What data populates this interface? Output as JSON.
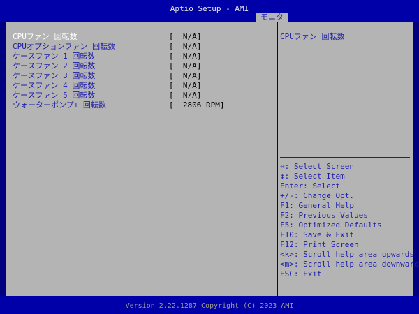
{
  "app": {
    "title": "Aptio Setup - AMI"
  },
  "tabs": [
    {
      "label": "モニタ",
      "active": true
    }
  ],
  "items": [
    {
      "label": "CPUファン 回転数",
      "value": "[  N/A]",
      "selected": true
    },
    {
      "label": "CPUオプションファン 回転数",
      "value": "[  N/A]"
    },
    {
      "label": "ケースファン 1 回転数",
      "value": "[  N/A]"
    },
    {
      "label": "ケースファン 2 回転数",
      "value": "[  N/A]"
    },
    {
      "label": "ケースファン 3 回転数",
      "value": "[  N/A]"
    },
    {
      "label": "ケースファン 4 回転数",
      "value": "[  N/A]"
    },
    {
      "label": "ケースファン 5 回転数",
      "value": "[  N/A]"
    },
    {
      "label": "ウォーターポンプ+ 回転数",
      "value": "[  2806 RPM]"
    }
  ],
  "help": {
    "description": "CPUファン 回転数",
    "keys": [
      "↔: Select Screen",
      "↕: Select Item",
      "Enter: Select",
      "+/-: Change Opt.",
      "F1: General Help",
      "F2: Previous Values",
      "F5: Optimized Defaults",
      "F10: Save & Exit",
      "F12: Print Screen",
      "<k>: Scroll help area upwards",
      "<m>: Scroll help area downwards",
      "ESC: Exit"
    ]
  },
  "footer": {
    "text": "Version 2.22.1287 Copyright (C) 2023 AMI"
  },
  "colors": {
    "background": "#000080",
    "panel": "#b4b4b4",
    "label_text": "#1c1caa",
    "selected_text": "#ffffff",
    "value_text": "#000000"
  }
}
